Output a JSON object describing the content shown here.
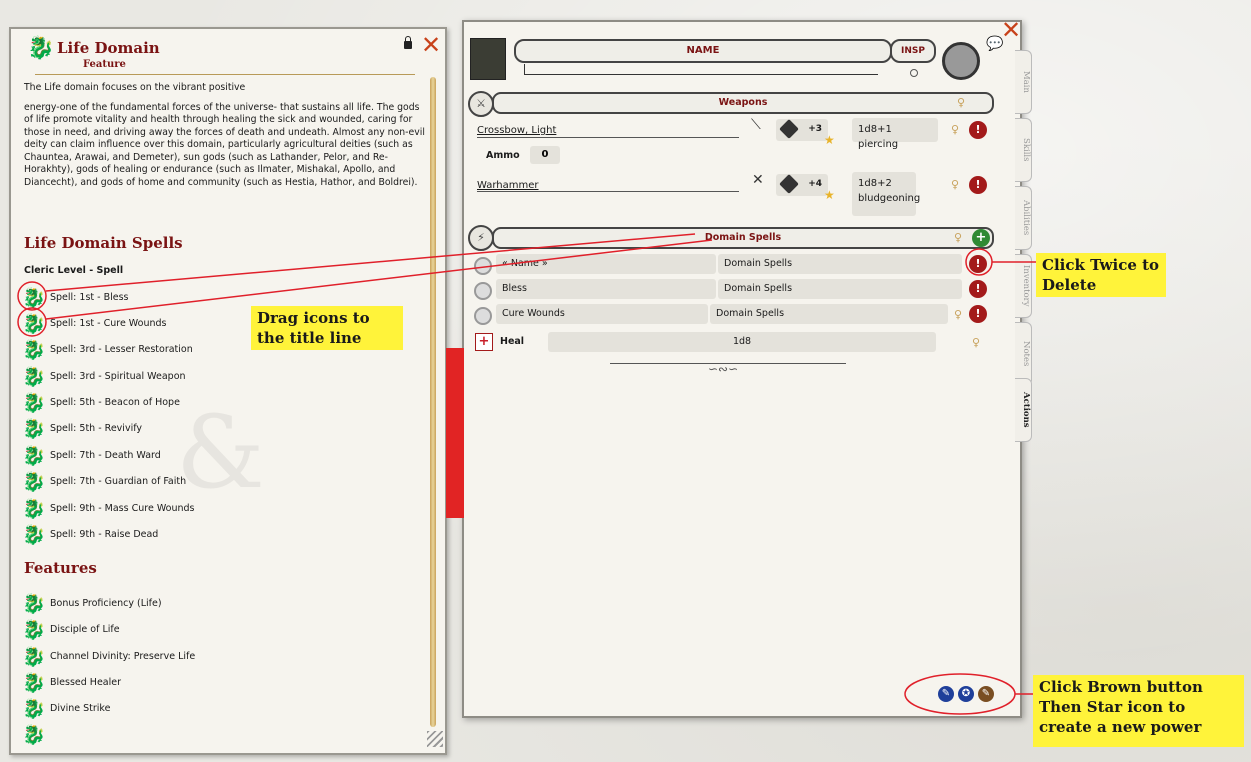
{
  "left_panel": {
    "title": "Life Domain",
    "subtitle": "Feature",
    "body": "The Life domain focuses on the vibrant positive",
    "body2": "energy-one of the fundamental forces of the universe- that sustains all life. The gods of life promote vitality and health through healing the sick and wounded, caring for those in need, and driving away the forces of death and undeath. Almost any non-evil deity can claim influence over this domain, particularly agricultural deities (such as Chauntea, Arawai, and Demeter), sun gods (such as Lathander, Pelor, and Re-Horakhty), gods of healing or endurance (such as Ilmater, Mishakal, Apollo, and Diancecht), and gods of home and community (such as Hestia, Hathor, and Boldrei).",
    "spells_heading": "Life Domain Spells",
    "cleric_level": "Cleric Level - Spell",
    "spells": [
      "Spell: 1st - Bless",
      "Spell: 1st - Cure Wounds",
      "Spell: 3rd - Lesser Restoration",
      "Spell: 3rd - Spiritual Weapon",
      "Spell: 5th - Beacon of Hope",
      "Spell: 5th - Revivify",
      "Spell: 7th - Death Ward",
      "Spell: 7th - Guardian of Faith",
      "Spell: 9th - Mass Cure Wounds",
      "Spell: 9th - Raise Dead"
    ],
    "features_heading": "Features",
    "features": [
      "Bonus Proficiency (Life)",
      "Disciple of Life",
      "Channel Divinity: Preserve Life",
      "Blessed Healer",
      "Divine Strike"
    ]
  },
  "sheet": {
    "name_label": "NAME",
    "insp_label": "INSP",
    "weapons_label": "Weapons",
    "weapons": [
      {
        "name": "Crossbow, Light",
        "bonus": "+3",
        "damage": "1d8+1 piercing"
      },
      {
        "name": "Warhammer",
        "bonus": "+4",
        "damage": "1d8+2 bludgeoning"
      }
    ],
    "ammo_label": "Ammo",
    "ammo_value": "0",
    "domain_label": "Domain Spells",
    "spell_rows": [
      {
        "name": "« Name »",
        "group": "Domain Spells"
      },
      {
        "name": "Bless",
        "group": "Domain Spells"
      },
      {
        "name": "Cure Wounds",
        "group": "Domain Spells"
      }
    ],
    "heal_label": "Heal",
    "heal_value": "1d8",
    "tabs": [
      "Main",
      "Skills",
      "Abilities",
      "Inventory",
      "Notes",
      "Actions"
    ]
  },
  "callouts": {
    "drag": "Drag icons to the title line",
    "delete": "Click Twice to Delete",
    "brown": "Click Brown button Then Star icon to create a new power"
  },
  "colors": {
    "accent": "#7a1313",
    "callout": "#fff33a",
    "annotation": "#e0202a"
  }
}
